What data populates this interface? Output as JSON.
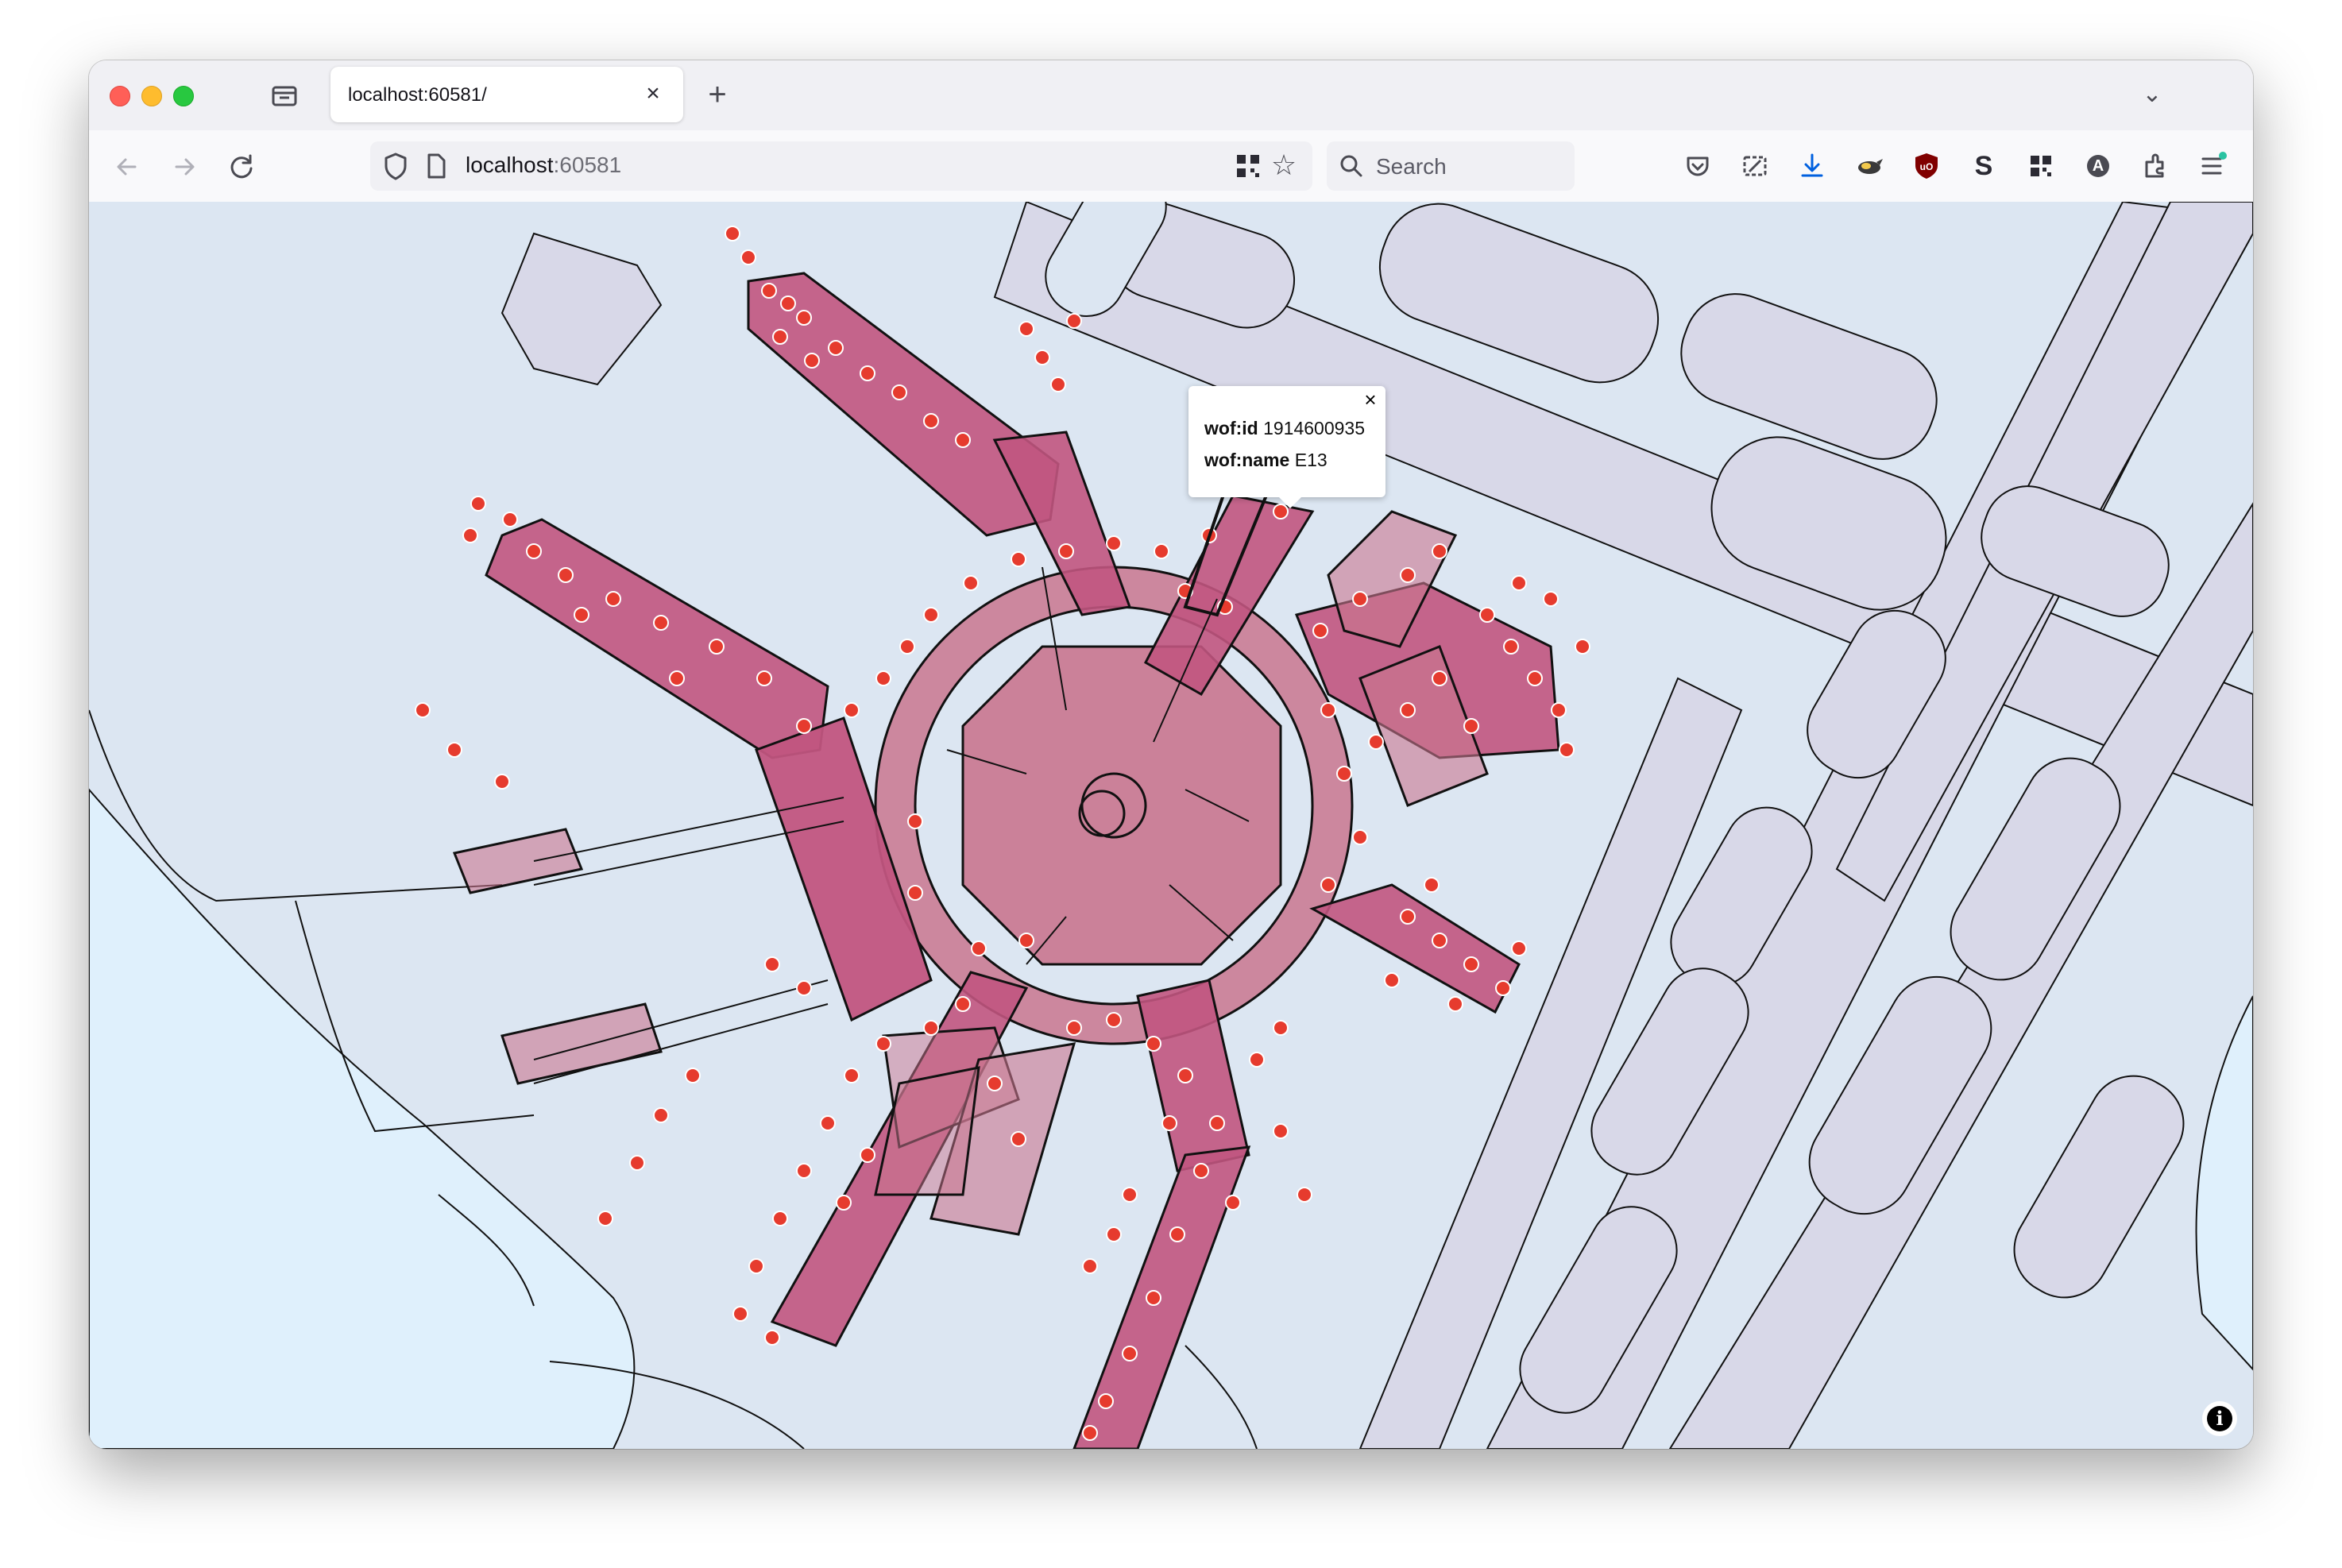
{
  "browser": {
    "tab": {
      "title": "localhost:60581/",
      "close_glyph": "×"
    },
    "new_tab_glyph": "+",
    "tabs_overflow_glyph": "⌄",
    "url": {
      "host": "localhost",
      "port": ":60581"
    },
    "search": {
      "placeholder": "Search"
    },
    "toolbar_icons": [
      "pocket-icon",
      "screenshot-icon",
      "downloads-icon",
      "extension-bird-icon",
      "ublock-icon",
      "s-extension-icon",
      "qr-extension-icon",
      "account-icon",
      "extensions-icon",
      "menu-icon"
    ],
    "account_initial": "A",
    "s_extension_letter": "S",
    "colors": {
      "download_accent": "#0060df",
      "ublock": "#800000",
      "update_dot": "#2ac3a2"
    }
  },
  "map": {
    "colors": {
      "background": "#dce6f2",
      "water": "#dff0fc",
      "airfield": "#d8d8e8",
      "venue_fill": "#c9768f",
      "venue_fill_dark": "#c1557f",
      "outline": "#111111",
      "poi_fill": "#e63b2e",
      "poi_stroke": "#ffffff",
      "poi_halo": "#e98a88"
    },
    "popup": {
      "close_glyph": "×",
      "rows": [
        {
          "key": "wof:id",
          "value": "1914600935"
        },
        {
          "key": "wof:name",
          "value": "E13"
        }
      ]
    },
    "info_glyph": "i"
  }
}
